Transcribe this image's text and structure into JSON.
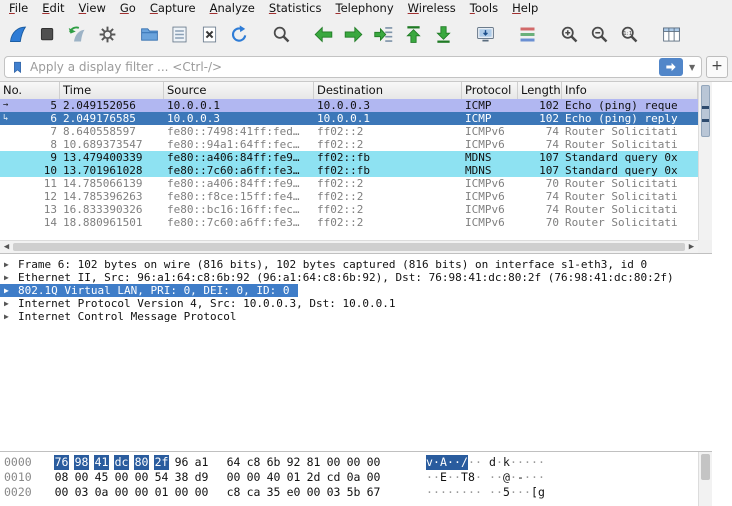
{
  "menu": {
    "items": [
      "File",
      "Edit",
      "View",
      "Go",
      "Capture",
      "Analyze",
      "Statistics",
      "Telephony",
      "Wireless",
      "Tools",
      "Help"
    ]
  },
  "toolbar": {
    "buttons": [
      {
        "name": "start-capture-button",
        "icon": "fin"
      },
      {
        "name": "stop-capture-button",
        "icon": "stop"
      },
      {
        "name": "restart-capture-button",
        "icon": "restart"
      },
      {
        "name": "capture-options-button",
        "icon": "gear"
      },
      {
        "name": "open-file-button",
        "icon": "folder",
        "gap": true
      },
      {
        "name": "save-file-button",
        "icon": "save"
      },
      {
        "name": "close-file-button",
        "icon": "close"
      },
      {
        "name": "reload-file-button",
        "icon": "reload"
      },
      {
        "name": "find-packet-button",
        "icon": "find",
        "gap": true
      },
      {
        "name": "go-back-button",
        "icon": "arrow-left",
        "gap": true
      },
      {
        "name": "go-forward-button",
        "icon": "arrow-right"
      },
      {
        "name": "go-to-packet-button",
        "icon": "goto"
      },
      {
        "name": "go-first-packet-button",
        "icon": "arrow-top"
      },
      {
        "name": "go-last-packet-button",
        "icon": "arrow-bottom"
      },
      {
        "name": "auto-scroll-button",
        "icon": "autoscroll",
        "gap": true
      },
      {
        "name": "colorize-button",
        "icon": "colorize",
        "gap": true
      },
      {
        "name": "zoom-in-button",
        "icon": "zoom-in",
        "gap": true
      },
      {
        "name": "zoom-out-button",
        "icon": "zoom-out"
      },
      {
        "name": "zoom-reset-button",
        "icon": "zoom-reset"
      },
      {
        "name": "resize-columns-button",
        "icon": "resize-columns",
        "gap": true
      }
    ]
  },
  "filter": {
    "placeholder": "Apply a display filter ... <Ctrl-/>",
    "add_label": "+"
  },
  "packet_list": {
    "columns": [
      "No.",
      "Time",
      "Source",
      "Destination",
      "Protocol",
      "Length",
      "Info"
    ],
    "rows": [
      {
        "no": "5",
        "time": "2.049152056",
        "source": "10.0.0.1",
        "destination": "10.0.0.3",
        "protocol": "ICMP",
        "length": "102",
        "info": "Echo (ping) reque",
        "style": "icmp",
        "related": "→"
      },
      {
        "no": "6",
        "time": "2.049176585",
        "source": "10.0.0.3",
        "destination": "10.0.0.1",
        "protocol": "ICMP",
        "length": "102",
        "info": "Echo (ping) reply",
        "style": "sel",
        "related": "↳"
      },
      {
        "no": "7",
        "time": "8.640558597",
        "source": "fe80::7498:41ff:fed…",
        "destination": "ff02::2",
        "protocol": "ICMPv6",
        "length": "74",
        "info": "Router Solicitati",
        "style": "gray",
        "related": ""
      },
      {
        "no": "8",
        "time": "10.689373547",
        "source": "fe80::94a1:64ff:fec…",
        "destination": "ff02::2",
        "protocol": "ICMPv6",
        "length": "74",
        "info": "Router Solicitati",
        "style": "gray",
        "related": ""
      },
      {
        "no": "9",
        "time": "13.479400339",
        "source": "fe80::a406:84ff:fe9…",
        "destination": "ff02::fb",
        "protocol": "MDNS",
        "length": "107",
        "info": "Standard query 0x",
        "style": "mdns",
        "related": ""
      },
      {
        "no": "10",
        "time": "13.701961028",
        "source": "fe80::7c60:a6ff:fe3…",
        "destination": "ff02::fb",
        "protocol": "MDNS",
        "length": "107",
        "info": "Standard query 0x",
        "style": "mdns",
        "related": ""
      },
      {
        "no": "11",
        "time": "14.785066139",
        "source": "fe80::a406:84ff:fe9…",
        "destination": "ff02::2",
        "protocol": "ICMPv6",
        "length": "70",
        "info": "Router Solicitati",
        "style": "gray",
        "related": ""
      },
      {
        "no": "12",
        "time": "14.785396263",
        "source": "fe80::f8ce:15ff:fe4…",
        "destination": "ff02::2",
        "protocol": "ICMPv6",
        "length": "74",
        "info": "Router Solicitati",
        "style": "gray",
        "related": ""
      },
      {
        "no": "13",
        "time": "16.833390326",
        "source": "fe80::bc16:16ff:fec…",
        "destination": "ff02::2",
        "protocol": "ICMPv6",
        "length": "74",
        "info": "Router Solicitati",
        "style": "gray",
        "related": ""
      },
      {
        "no": "14",
        "time": "18.880961501",
        "source": "fe80::7c60:a6ff:fe3…",
        "destination": "ff02::2",
        "protocol": "ICMPv6",
        "length": "70",
        "info": "Router Solicitati",
        "style": "gray",
        "related": ""
      }
    ]
  },
  "details": {
    "rows": [
      {
        "text": "Frame 6: 102 bytes on wire (816 bits), 102 bytes captured (816 bits) on interface s1-eth3, id 0",
        "selected": false
      },
      {
        "text": "Ethernet II, Src: 96:a1:64:c8:6b:92 (96:a1:64:c8:6b:92), Dst: 76:98:41:dc:80:2f (76:98:41:dc:80:2f)",
        "selected": false
      },
      {
        "text": "802.1Q Virtual LAN, PRI: 0, DEI: 0, ID: 0",
        "selected": true
      },
      {
        "text": "Internet Protocol Version 4, Src: 10.0.0.3, Dst: 10.0.0.1",
        "selected": false
      },
      {
        "text": "Internet Control Message Protocol",
        "selected": false
      }
    ]
  },
  "hex": {
    "lines": [
      {
        "offset": "0000",
        "bytes": [
          "76",
          "98",
          "41",
          "dc",
          "80",
          "2f",
          "96",
          "a1",
          "64",
          "c8",
          "6b",
          "92",
          "81",
          "00",
          "00",
          "00"
        ],
        "ascii": "v·A··/··d·k·····"
      },
      {
        "offset": "0010",
        "bytes": [
          "08",
          "00",
          "45",
          "00",
          "00",
          "54",
          "38",
          "d9",
          "00",
          "00",
          "40",
          "01",
          "2d",
          "cd",
          "0a",
          "00"
        ],
        "ascii": "··E··T8···@·-···"
      },
      {
        "offset": "0020",
        "bytes": [
          "00",
          "03",
          "0a",
          "00",
          "00",
          "01",
          "00",
          "00",
          "c8",
          "ca",
          "35",
          "e0",
          "00",
          "03",
          "5b",
          "67"
        ],
        "ascii": "··········5···[g"
      }
    ],
    "highlight": {
      "line": 0,
      "start": 0,
      "end": 5
    }
  },
  "colors": {
    "selected_row": "#3c77b8",
    "icmp_row": "#b1b7f1",
    "mdns_row": "#8ee2f2",
    "muted_row_text": "#7f7f7f",
    "detail_selection": "#3f7dc8",
    "hex_selection": "#2a5c9e",
    "accent_blue": "#2e7cd6",
    "nav_green": "#3aa83f"
  }
}
